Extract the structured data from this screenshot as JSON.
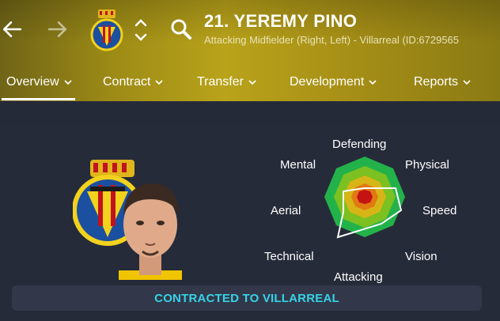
{
  "header": {
    "title": "21. YEREMY PINO",
    "subtitle": "Attacking Midfielder (Right, Left) - Villarreal (ID:6729565"
  },
  "tabs": [
    {
      "label": "Overview",
      "active": true
    },
    {
      "label": "Contract"
    },
    {
      "label": "Transfer"
    },
    {
      "label": "Development"
    },
    {
      "label": "Reports"
    }
  ],
  "radar": {
    "labels": {
      "top": "Defending",
      "top_right": "Physical",
      "right": "Speed",
      "bottom_right": "Vision",
      "bottom": "Attacking",
      "bottom_left": "Technical",
      "left": "Aerial",
      "top_left": "Mental"
    },
    "ring_colors": [
      "#23b24a",
      "#7cc021",
      "#d8b516",
      "#e07a12",
      "#c51212"
    ]
  },
  "banner": {
    "text": "CONTRACTED TO VILLARREAL"
  },
  "icons": {
    "back": "arrow-left-icon",
    "forward": "arrow-right-icon",
    "club": "villarreal-crest-icon",
    "updown": "chevron-updown-icon",
    "search": "search-icon"
  }
}
